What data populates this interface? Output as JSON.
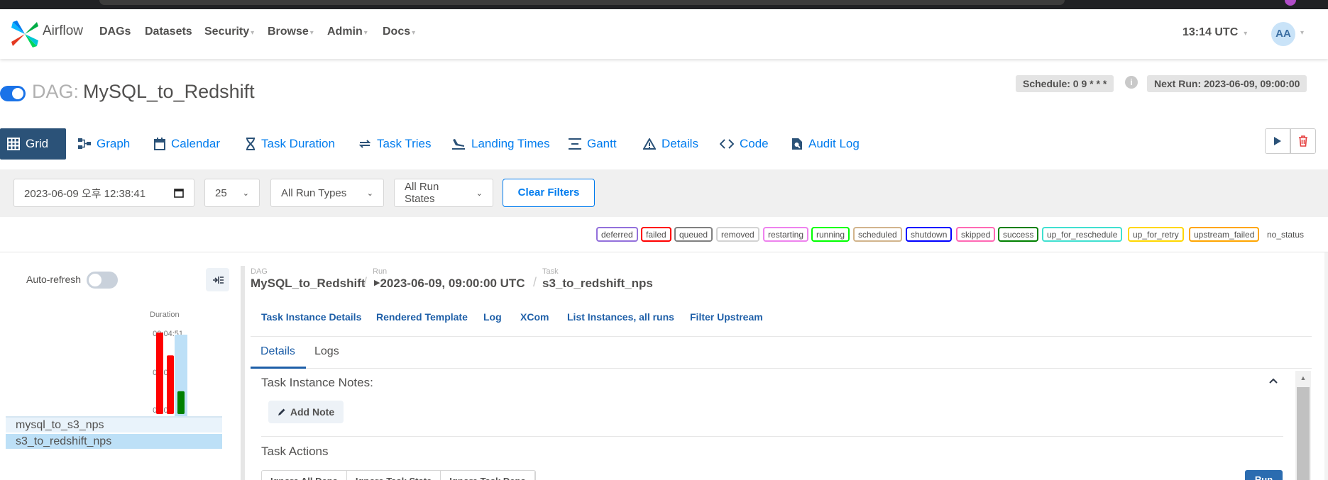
{
  "app": {
    "brand": "Airflow",
    "nav": [
      {
        "label": "DAGs",
        "caret": ""
      },
      {
        "label": "Datasets",
        "caret": ""
      },
      {
        "label": "Security",
        "caret": "▾"
      },
      {
        "label": "Browse",
        "caret": "▾"
      },
      {
        "label": "Admin",
        "caret": "▾"
      },
      {
        "label": "Docs",
        "caret": "▾"
      }
    ],
    "clock": "13:14 UTC",
    "avatar": "AA"
  },
  "dag": {
    "prefix": "DAG:",
    "name": "MySQL_to_Redshift",
    "paused": false,
    "schedule": "Schedule: 0 9 * * *",
    "next_run": "Next Run: 2023-06-09, 09:00:00"
  },
  "tabs": [
    {
      "label": "Grid",
      "icon": "grid-icon",
      "active": true
    },
    {
      "label": "Graph",
      "icon": "graph-icon",
      "active": false
    },
    {
      "label": "Calendar",
      "icon": "calendar-icon",
      "active": false
    },
    {
      "label": "Task Duration",
      "icon": "hourglass-icon",
      "active": false
    },
    {
      "label": "Task Tries",
      "icon": "retry-icon",
      "active": false
    },
    {
      "label": "Landing Times",
      "icon": "landing-icon",
      "active": false
    },
    {
      "label": "Gantt",
      "icon": "gantt-icon",
      "active": false
    },
    {
      "label": "Details",
      "icon": "warning-triangle-icon",
      "active": false
    },
    {
      "label": "Code",
      "icon": "code-icon",
      "active": false
    },
    {
      "label": "Audit Log",
      "icon": "search-file-icon",
      "active": false
    }
  ],
  "filters": {
    "base_date": "2023-06-09 오후 12:38:41",
    "num_runs": "25",
    "run_type": "All Run Types",
    "run_state": "All Run States",
    "clear_label": "Clear Filters"
  },
  "legend": [
    {
      "label": "deferred",
      "color": "#9370db"
    },
    {
      "label": "failed",
      "color": "#ff0000"
    },
    {
      "label": "queued",
      "color": "#808080"
    },
    {
      "label": "removed",
      "color": "#d3d3d3"
    },
    {
      "label": "restarting",
      "color": "#ee82ee"
    },
    {
      "label": "running",
      "color": "#00ff00"
    },
    {
      "label": "scheduled",
      "color": "#d2b48c"
    },
    {
      "label": "shutdown",
      "color": "#0000ff"
    },
    {
      "label": "skipped",
      "color": "#ff69b4"
    },
    {
      "label": "success",
      "color": "#008000"
    },
    {
      "label": "up_for_reschedule",
      "color": "#40e0d0"
    },
    {
      "label": "up_for_retry",
      "color": "#ffd700"
    },
    {
      "label": "upstream_failed",
      "color": "#ffa500"
    },
    {
      "label": "no_status",
      "color": "none"
    }
  ],
  "grid": {
    "auto_refresh_label": "Auto-refresh",
    "duration_label": "Duration",
    "ticks": [
      "00:04:51",
      "00:02:25",
      "00:00:00"
    ],
    "runs": [
      {
        "duration_fraction": 1.0,
        "state": "failed"
      },
      {
        "duration_fraction": 0.72,
        "state": "failed"
      },
      {
        "duration_fraction": 0.28,
        "state": "success",
        "selected": true
      }
    ],
    "tasks": [
      {
        "name": "mysql_to_s3_nps",
        "states": [
          "success",
          "success",
          "success"
        ]
      },
      {
        "name": "s3_to_redshift_nps",
        "states": [
          "failed",
          "failed",
          "success"
        ],
        "selected": true
      }
    ]
  },
  "detail": {
    "breadcrumb": {
      "dag_label": "DAG",
      "dag_value": "MySQL_to_Redshift",
      "run_label": "Run",
      "run_value": "2023-06-09, 09:00:00 UTC",
      "task_label": "Task",
      "task_value": "s3_to_redshift_nps",
      "separator": "/"
    },
    "sub_links": [
      "Task Instance Details",
      "Rendered Template",
      "Log",
      "XCom",
      "List Instances, all runs",
      "Filter Upstream"
    ],
    "inner_tabs": [
      "Details",
      "Logs"
    ],
    "notes_title": "Task Instance Notes:",
    "add_note": "Add Note",
    "actions_title": "Task Actions",
    "action_buttons": [
      "Ignore All Deps",
      "Ignore Task State",
      "Ignore Task Deps"
    ],
    "run_button": "Run"
  }
}
